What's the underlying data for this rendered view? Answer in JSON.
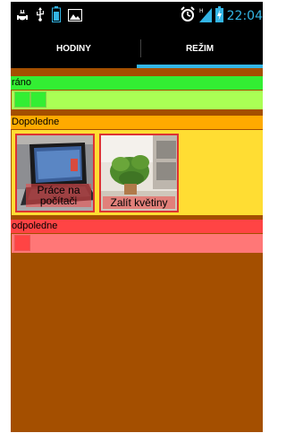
{
  "status_bar": {
    "time": "22:04",
    "icons": [
      "android-debug-icon",
      "usb-icon",
      "battery-sd-icon",
      "image-icon",
      "alarm-icon",
      "signal-icon",
      "battery-charging-icon"
    ]
  },
  "tabs": [
    {
      "label": "HODINY",
      "selected": false
    },
    {
      "label": "REŽIM",
      "selected": true
    }
  ],
  "colors": {
    "accent": "#33b5e5",
    "background": "#a44f00",
    "morning_header": "#33ee33",
    "morning_strip": "#aaff55",
    "forenoon_header": "#ffaa00",
    "forenoon_body": "#ffdd33",
    "afternoon_header": "#ff4444",
    "afternoon_strip": "#ff7777"
  },
  "sections": {
    "morning": {
      "title": "ráno",
      "slots": 2
    },
    "forenoon": {
      "title": "Dopoledne",
      "cards": [
        {
          "label": "Práce na počítači"
        },
        {
          "label": "Zalít květiny"
        }
      ]
    },
    "afternoon": {
      "title": "odpoledne",
      "slots": 1
    }
  }
}
